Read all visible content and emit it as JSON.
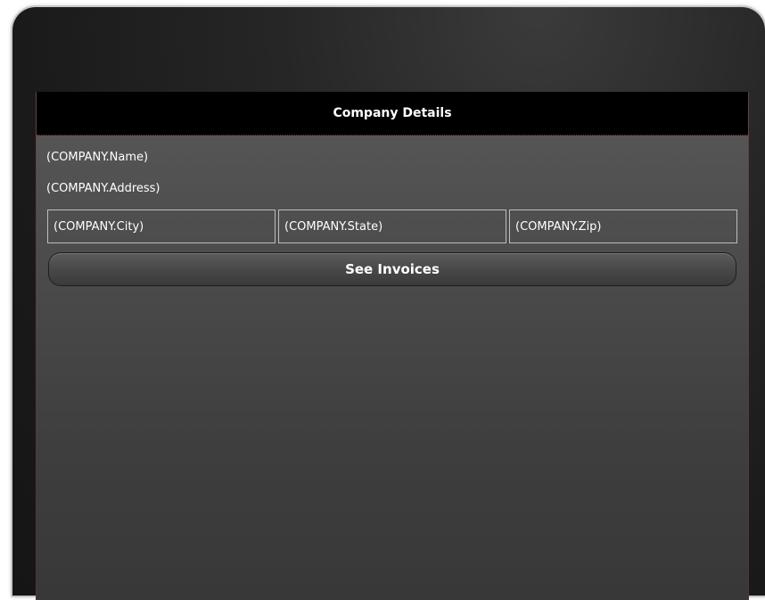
{
  "header": {
    "title": "Company Details"
  },
  "company": {
    "name": "(COMPANY.Name)",
    "address": "(COMPANY.Address)",
    "city": "(COMPANY.City)",
    "state": "(COMPANY.State)",
    "zip": "(COMPANY.Zip)"
  },
  "actions": {
    "see_invoices_label": "See Invoices"
  }
}
